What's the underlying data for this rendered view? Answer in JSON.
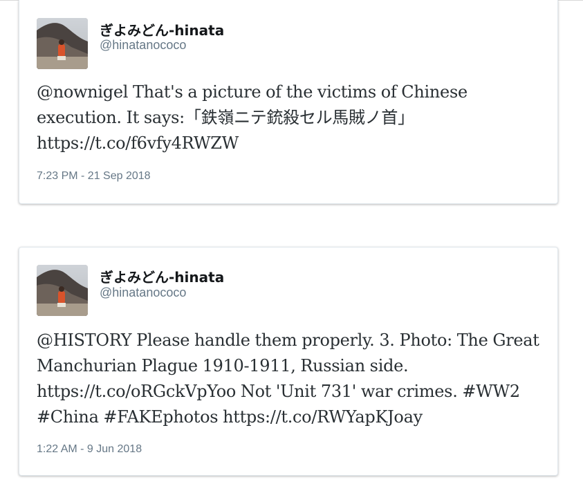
{
  "tweets": [
    {
      "display_name": "ぎよみどん-hinata",
      "handle": "@hinatanococo",
      "text": "@nownigel That's a picture of the victims of Chinese execution. It says:「鉄嶺ニテ銃殺セル馬賊ノ首」 https://t.co/f6vfy4RWZW",
      "timestamp": "7:23 PM - 21 Sep 2018"
    },
    {
      "display_name": "ぎよみどん-hinata",
      "handle": "@hinatanococo",
      "text": "@HISTORY Please handle them properly. 3. Photo: The Great Manchurian Plague 1910-1911, Russian side. https://t.co/oRGckVpYoo Not 'Unit 731' war crimes. #WW2 #China #FAKEphotos https://t.co/RWYapKJoay",
      "timestamp": "1:22 AM - 9 Jun 2018"
    }
  ]
}
